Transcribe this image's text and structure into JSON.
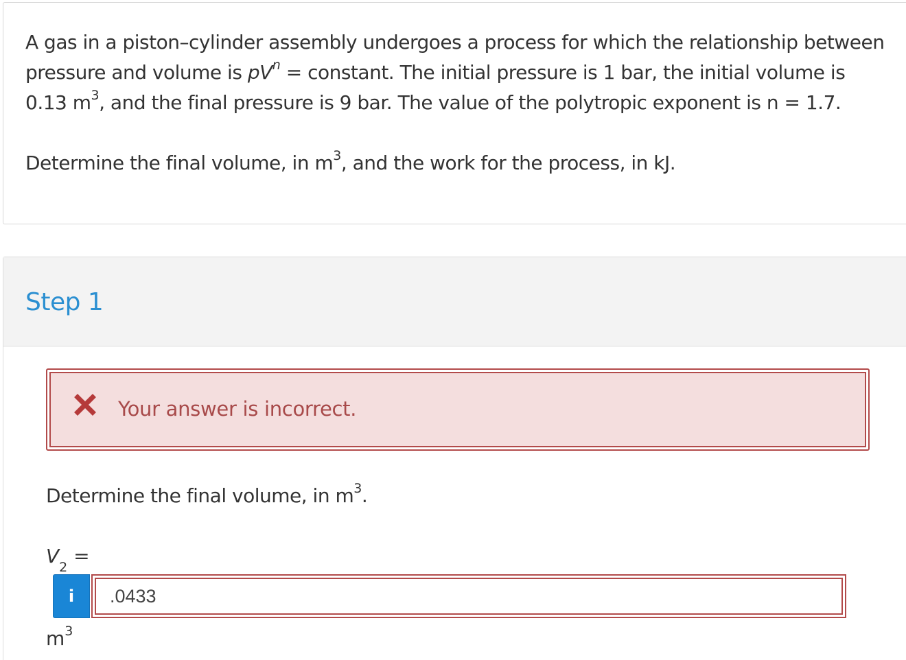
{
  "question": {
    "line1": "A gas in a piston–cylinder assembly undergoes a process for which the relationship between pressure and volume is ",
    "formula_p": "pV",
    "formula_exp": "n",
    "line2": " = constant. The initial pressure is 1 bar, the initial volume is 0.13 m",
    "unit_exp": "3",
    "line3": ", and the final pressure is 9 bar.  The value of the polytropic exponent is n = 1.7.",
    "prompt_pre": "Determine the final volume, in m",
    "prompt_exp": "3",
    "prompt_post": ", and the work for the process, in kJ."
  },
  "step": {
    "title": "Step 1"
  },
  "alert": {
    "icon": "x-icon",
    "message": "Your answer is incorrect.",
    "color": "#a84a4a",
    "background": "#f4dede"
  },
  "sub_question": {
    "pre": "Determine the final volume, in m",
    "exp": "3",
    "post": "."
  },
  "answer": {
    "variable": "V",
    "subscript": "2",
    "equals": " =",
    "info_icon": "i",
    "value": ".0433",
    "unit_base": "m",
    "unit_exp": "3"
  },
  "colors": {
    "step_title": "#2b8fd1",
    "info_button": "#1a86d6",
    "error_border": "#b24a4a"
  }
}
